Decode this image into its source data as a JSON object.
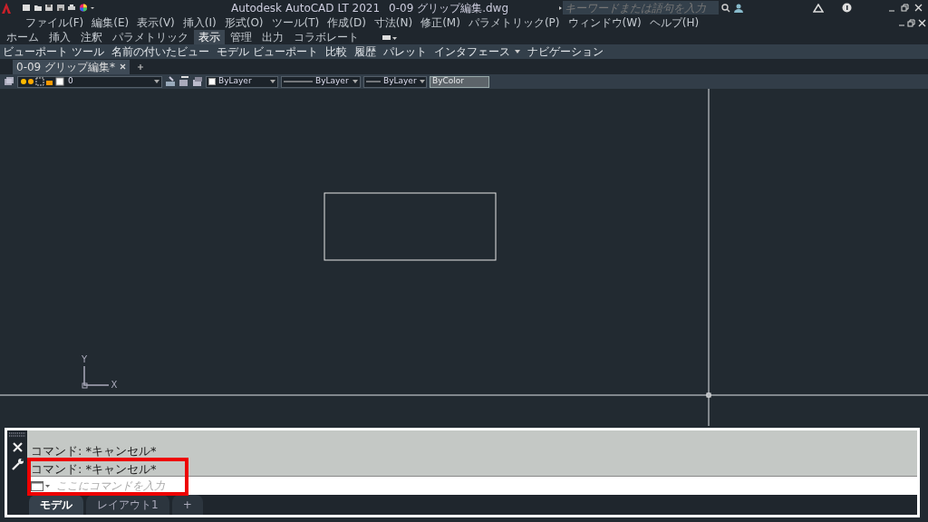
{
  "title_bar": {
    "app_title": "Autodesk AutoCAD LT 2021",
    "file_name": "0-09 グリップ編集.dwg",
    "search": {
      "placeholder": "キーワードまたは語句を入力"
    }
  },
  "menu": [
    "ファイル(F)",
    "編集(E)",
    "表示(V)",
    "挿入(I)",
    "形式(O)",
    "ツール(T)",
    "作成(D)",
    "寸法(N)",
    "修正(M)",
    "パラメトリック(P)",
    "ウィンドウ(W)",
    "ヘルプ(H)"
  ],
  "ribbon_tabs": [
    {
      "label": "ホーム",
      "selected": false
    },
    {
      "label": "挿入",
      "selected": false
    },
    {
      "label": "注釈",
      "selected": false
    },
    {
      "label": "パラメトリック",
      "selected": false
    },
    {
      "label": "表示",
      "selected": true
    },
    {
      "label": "管理",
      "selected": false
    },
    {
      "label": "出力",
      "selected": false
    },
    {
      "label": "コラボレート",
      "selected": false
    }
  ],
  "ribbon_panels": [
    {
      "label": "ビューポート ツール",
      "has_menu": false
    },
    {
      "label": "名前の付いたビュー",
      "has_menu": false
    },
    {
      "label": "モデル ビューポート",
      "has_menu": false
    },
    {
      "label": "比較",
      "has_menu": false
    },
    {
      "label": "履歴",
      "has_menu": false
    },
    {
      "label": "パレット",
      "has_menu": false
    },
    {
      "label": "インタフェース",
      "has_menu": true
    },
    {
      "label": "ナビゲーション",
      "has_menu": false
    }
  ],
  "document_tabs": [
    {
      "label": "0-09 グリップ編集*",
      "selected": true
    }
  ],
  "layer_toolbar": {
    "layer": "0",
    "color_setting": "ByLayer",
    "linetype": "ByLayer",
    "lineweight": "ByLayer",
    "plot_style": {
      "value": "ByColor",
      "disabled": true
    }
  },
  "ucs": {
    "x_label": "X",
    "y_label": "Y"
  },
  "command_window": {
    "history": [
      "コマンド: *キャンセル*",
      "コマンド: *キャンセル*"
    ],
    "placeholder": "ここにコマンドを入力"
  },
  "layout_tabs": [
    {
      "label": "モデル",
      "selected": true
    },
    {
      "label": "レイアウト1",
      "selected": false
    }
  ],
  "add_layout_label": "+"
}
